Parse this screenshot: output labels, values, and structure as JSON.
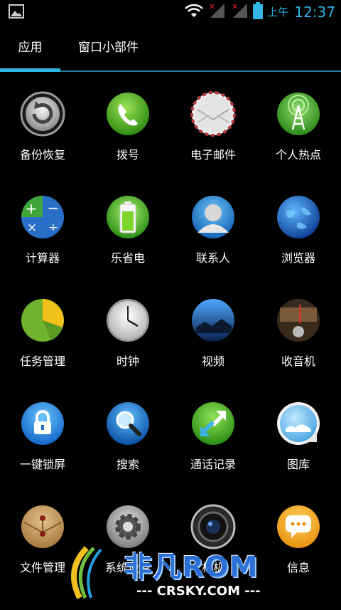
{
  "status_bar": {
    "ampm": "上午",
    "time": "12:37",
    "accent": "#33b5e5"
  },
  "tabs": [
    {
      "label": "应用",
      "active": true
    },
    {
      "label": "窗口小部件",
      "active": false
    }
  ],
  "apps": [
    {
      "label": "备份恢复",
      "icon": "backup-restore-icon"
    },
    {
      "label": "拨号",
      "icon": "phone-icon"
    },
    {
      "label": "电子邮件",
      "icon": "email-icon"
    },
    {
      "label": "个人热点",
      "icon": "hotspot-icon"
    },
    {
      "label": "计算器",
      "icon": "calculator-icon"
    },
    {
      "label": "乐省电",
      "icon": "battery-saver-icon"
    },
    {
      "label": "联系人",
      "icon": "contacts-icon"
    },
    {
      "label": "浏览器",
      "icon": "browser-globe-icon"
    },
    {
      "label": "任务管理",
      "icon": "task-manager-pie-icon"
    },
    {
      "label": "时钟",
      "icon": "clock-icon"
    },
    {
      "label": "视频",
      "icon": "video-icon"
    },
    {
      "label": "收音机",
      "icon": "radio-icon"
    },
    {
      "label": "一键锁屏",
      "icon": "lock-icon"
    },
    {
      "label": "搜索",
      "icon": "search-icon"
    },
    {
      "label": "通话记录",
      "icon": "call-log-icon"
    },
    {
      "label": "图库",
      "icon": "gallery-icon"
    },
    {
      "label": "文件管理",
      "icon": "file-manager-icon"
    },
    {
      "label": "系统设置",
      "icon": "settings-gear-icon"
    },
    {
      "label": "相机",
      "icon": "camera-icon"
    },
    {
      "label": "信息",
      "icon": "messaging-icon"
    }
  ],
  "watermark": {
    "brand": "非凡ROM",
    "site": "--- CRSKY.COM ---"
  }
}
